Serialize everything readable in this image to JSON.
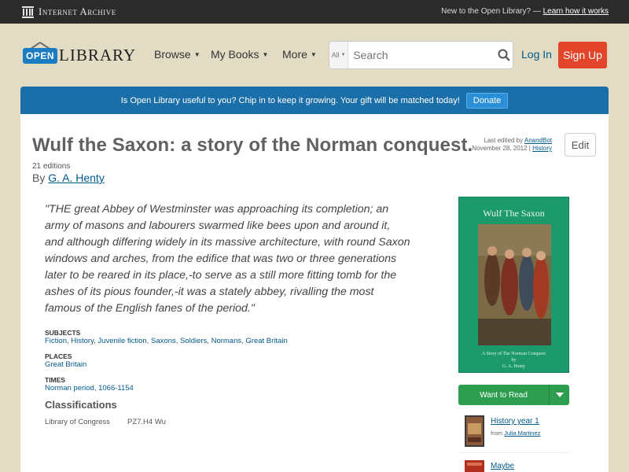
{
  "ia_bar": {
    "logo_text": "Internet Archive",
    "promo_text": "New to the Open Library? —",
    "promo_link": "Learn how it works"
  },
  "header": {
    "logo_badge": "OPEN",
    "logo_word": "LIBRARY",
    "nav": [
      "Browse",
      "My Books",
      "More"
    ],
    "search_scope": "All",
    "search_placeholder": "Search",
    "login": "Log In",
    "signup": "Sign Up"
  },
  "banner": {
    "text": "Is Open Library useful to you? Chip in to keep it growing. Your gift will be matched today!",
    "button": "Donate"
  },
  "book": {
    "title": "Wulf the Saxon: a story of the Norman conquest.",
    "last_edited_prefix": "Last edited by",
    "last_edited_by": "AnandBot",
    "last_edited_date": "November 28, 2012 |",
    "history_link": "History",
    "edit_label": "Edit",
    "editions": "21 editions",
    "by_prefix": "By",
    "author": "G. A. Henty",
    "excerpt_lines": [
      "\"THE great Abbey of Westminster was approaching its completion; an",
      "army of masons and labourers swarmed like bees upon and around it,",
      "and although differing widely in its massive architecture, with round Saxon",
      "windows and arches, from the edifice that was two or three generations",
      "later to be reared in its place,-to serve as a still more fitting tomb for the",
      "ashes of its pious founder,-it was a stately abbey, rivalling the most",
      "famous of the English fanes of the period.\""
    ],
    "subjects_label": "Subjects",
    "subjects": [
      "Fiction",
      "History",
      "Juvenile fiction",
      "Saxons",
      "Soldiers",
      "Normans",
      "Great Britain"
    ],
    "places_label": "Places",
    "places": [
      "Great Britain"
    ],
    "times_label": "Times",
    "times": [
      "Norman period, 1066-1154"
    ],
    "classifications_label": "Classifications",
    "classification_name": "Library of Congress",
    "classification_value": "PZ7.H4 Wu"
  },
  "cover": {
    "title": "Wulf The Saxon",
    "subtitle_1": "A Story of The Norman Conquest",
    "subtitle_2": "by",
    "subtitle_3": "G. A. Henty"
  },
  "sidebar": {
    "want_to_read": "Want to Read",
    "lists": [
      {
        "name": "History year 1",
        "from_prefix": "from",
        "from": "Julia Martinez"
      },
      {
        "name": "Maybe",
        "from_prefix": "",
        "from": ""
      }
    ]
  },
  "colors": {
    "ia_bar": "#2b2b2b",
    "page_bg": "#e2dcc5",
    "banner": "#1b6fa8",
    "signup": "#e3452b",
    "want_to_read": "#2d9e50",
    "cover": "#1c9a6c",
    "link": "#02598b"
  }
}
